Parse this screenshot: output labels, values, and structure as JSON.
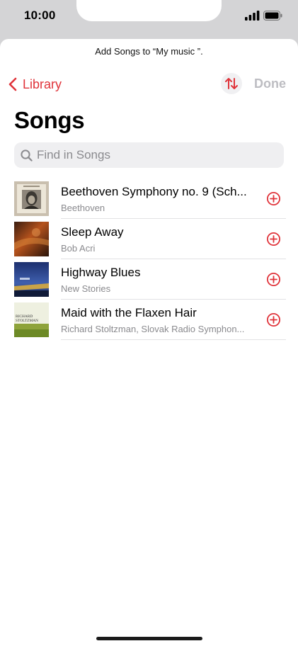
{
  "status_bar": {
    "time": "10:00",
    "signal_icon": "cellular-signal-icon",
    "battery_icon": "battery-full-icon"
  },
  "sheet": {
    "prompt": "Add Songs to “My music ”."
  },
  "nav": {
    "back_label": "Library",
    "back_icon": "chevron-left-icon",
    "sort_icon": "sort-arrows-icon",
    "done_label": "Done"
  },
  "title": "Songs",
  "search": {
    "placeholder": "Find in Songs",
    "icon": "search-icon"
  },
  "songs": [
    {
      "title": "Beethoven Symphony no. 9 (Sch...",
      "artist": "Beethoven"
    },
    {
      "title": "Sleep Away",
      "artist": "Bob Acri"
    },
    {
      "title": "Highway Blues",
      "artist": "New Stories"
    },
    {
      "title": "Maid with the Flaxen Hair",
      "artist": "Richard Stoltzman, Slovak Radio Symphon..."
    }
  ],
  "album_art_text": {
    "maid_line1": "RICHARD",
    "maid_line2": "STOLTZMAN"
  },
  "colors": {
    "accent": "#e0333a",
    "secondary_text": "#8a8a8e",
    "disabled": "#bdbdc2",
    "search_bg": "#efeff1"
  }
}
